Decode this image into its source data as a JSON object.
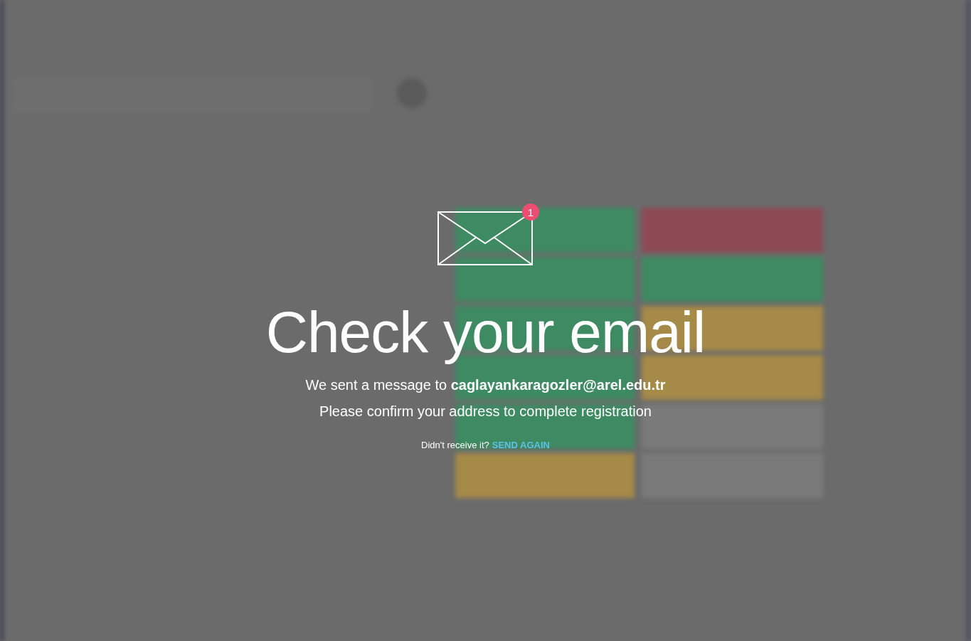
{
  "dialog": {
    "badge": "1",
    "title": "Check your email",
    "message": "We sent a message to **caglayankaragozler@arel.edu.tr**",
    "instruction": "Please confirm your address to complete registration",
    "resend_prompt": "Didn't receive it?",
    "resend_link": "SEND AGAIN"
  }
}
